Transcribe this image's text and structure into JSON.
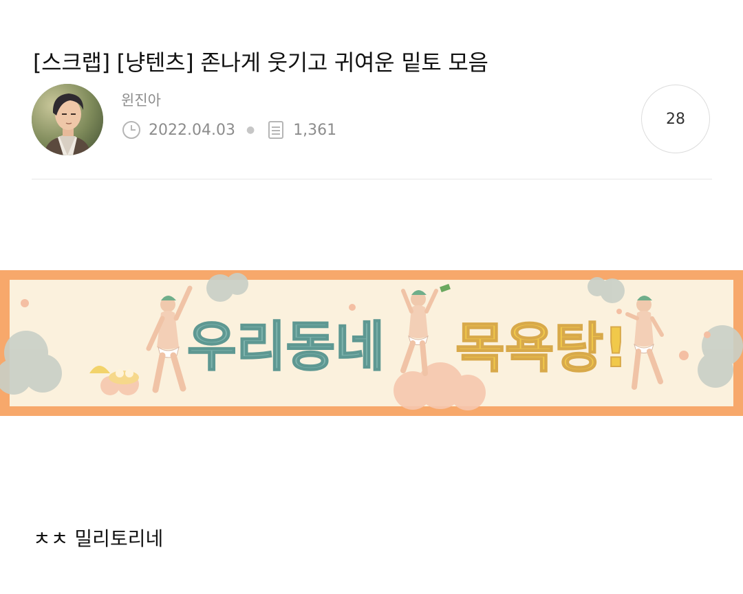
{
  "post": {
    "title": "[스크랩] [냥텐츠] 존나게 웃기고 귀여운 밑토 모음",
    "author": "윈진아",
    "date": "2022.04.03",
    "views": "1,361",
    "comments": "28",
    "content_text": "ㅊㅊ 밀리토리네"
  },
  "banner": {
    "text_left": "우리동네",
    "text_right": "목욕탕!",
    "frame_color": "#f7a86b",
    "bg_color": "#fbf1dd"
  },
  "icons": {
    "date": "clock-icon",
    "views": "document-icon"
  }
}
